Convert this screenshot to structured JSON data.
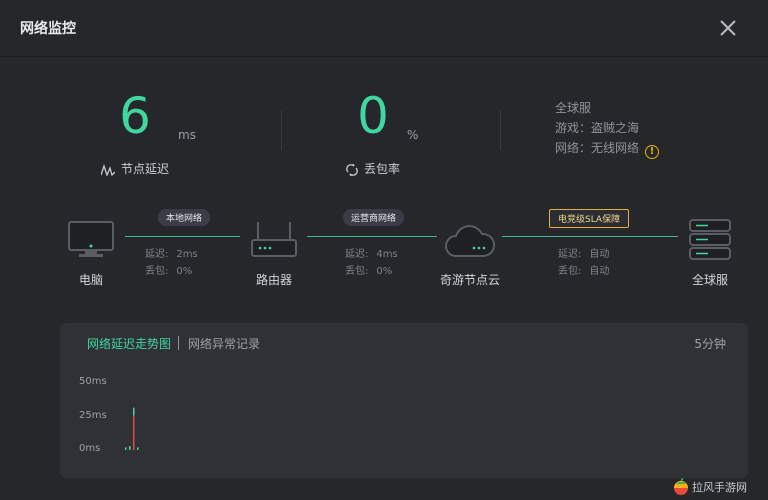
{
  "window": {
    "title": "网络监控"
  },
  "stats": {
    "latency": {
      "value": "6",
      "unit": "ms",
      "label": "节点延迟"
    },
    "loss": {
      "value": "0",
      "unit": "%",
      "label": "丢包率"
    }
  },
  "info": {
    "server": "全球服",
    "game": "游戏：盗贼之海",
    "network": "网络：无线网络"
  },
  "topology": {
    "nodes": {
      "pc": "电脑",
      "router": "路由器",
      "cloud": "奇游节点云",
      "server": "全球服"
    },
    "links": [
      {
        "tag": "本地网络",
        "delay_label": "延迟:",
        "delay": "2ms",
        "loss_label": "丢包:",
        "loss": "0%"
      },
      {
        "tag": "运营商网络",
        "delay_label": "延迟:",
        "delay": "4ms",
        "loss_label": "丢包:",
        "loss": "0%"
      },
      {
        "tag": "电竞级SLA保障",
        "delay_label": "延迟:",
        "delay": "自动",
        "loss_label": "丢包:",
        "loss": "自动"
      }
    ]
  },
  "chart_panel": {
    "tab_active": "网络延迟走势图",
    "tab_other": "网络异常记录",
    "period": "5分钟"
  },
  "chart_data": {
    "type": "bar",
    "title": "",
    "xlabel": "",
    "ylabel": "",
    "ylim": [
      0,
      50
    ],
    "yticks": [
      "50ms",
      "25ms",
      "0ms"
    ],
    "series": [
      {
        "color": "#e0484f",
        "values": [
          26
        ]
      },
      {
        "color": "#3fd6a0",
        "values": [
          2,
          3,
          2
        ]
      }
    ]
  },
  "colors": {
    "accent": "#3fd6a0",
    "warn": "#e4b400",
    "spike": "#e0484f"
  },
  "watermark": {
    "text": "拉风手游网"
  }
}
